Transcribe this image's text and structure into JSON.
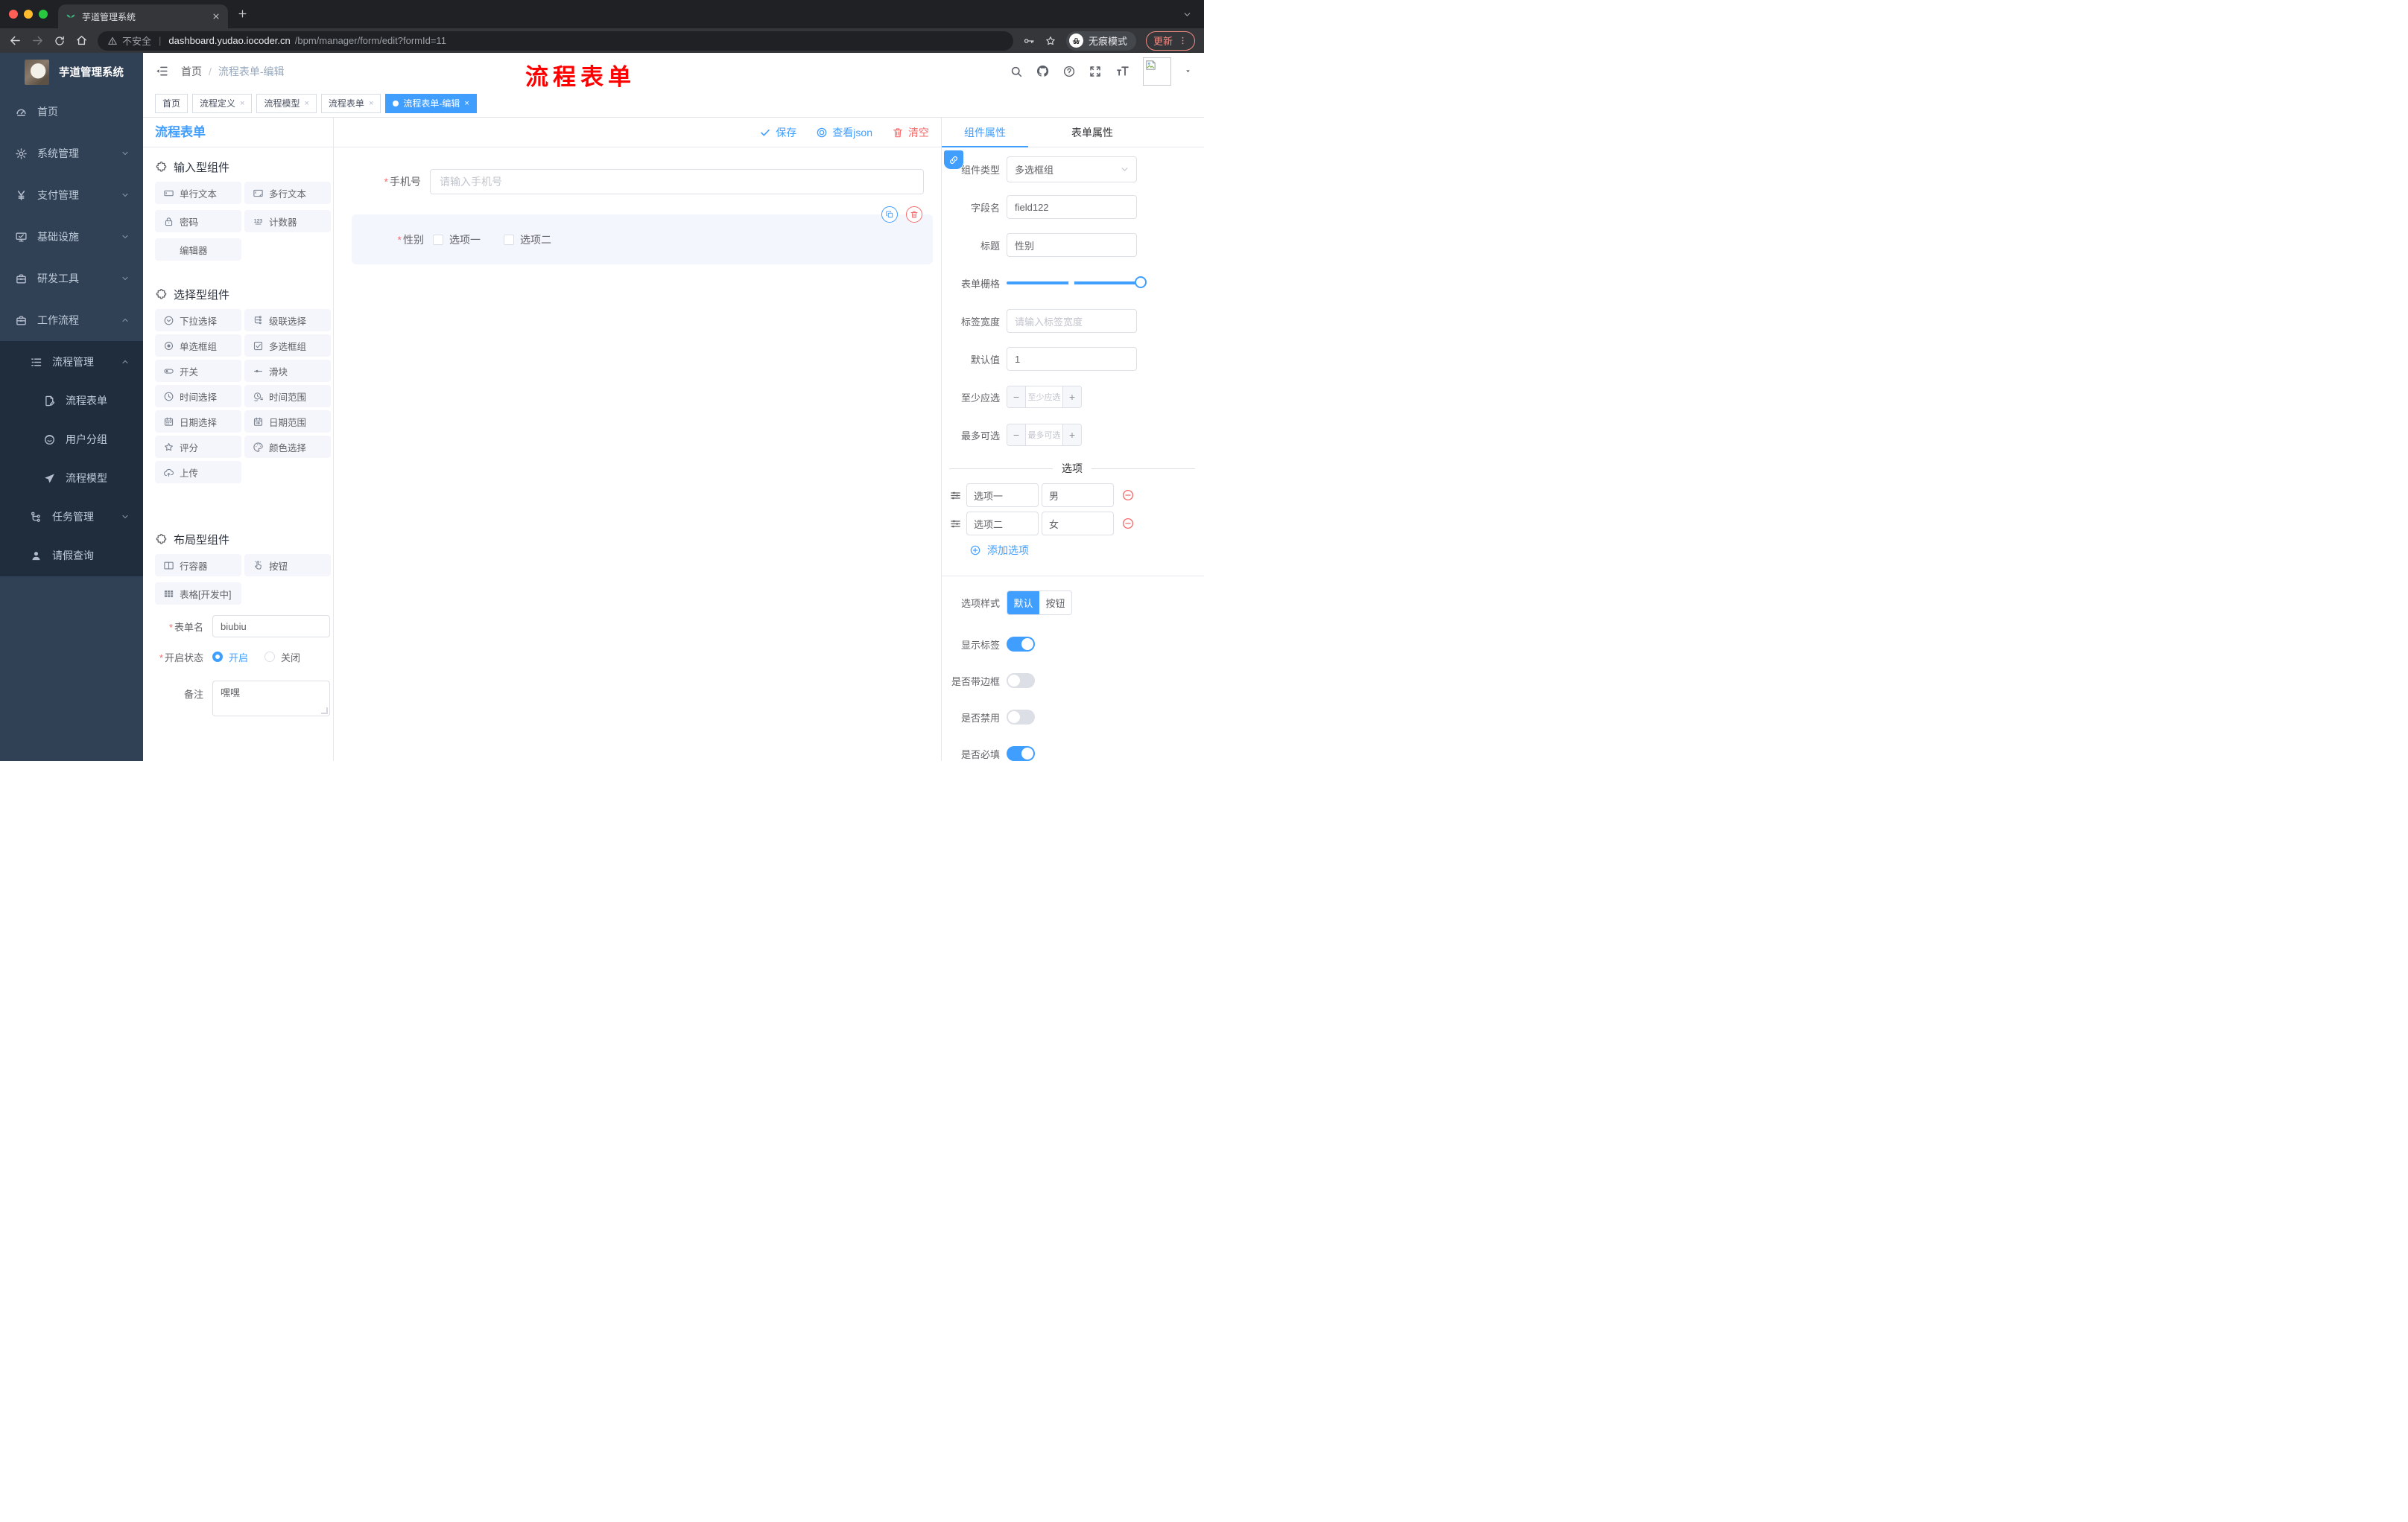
{
  "colors": {
    "primary": "#409eff",
    "danger": "#f56c6c",
    "sidebar_bg": "#304156",
    "submenu_bg": "#1f2d3d",
    "annotation": "#fe0000",
    "active_tab": "#409eff"
  },
  "browser": {
    "tab": {
      "title": "芋道管理系统"
    },
    "url": {
      "security": "不安全",
      "host": "dashboard.yudao.iocoder.cn",
      "path": "/bpm/manager/form/edit?formId=11"
    },
    "incognito_label": "无痕模式",
    "update_label": "更新"
  },
  "annotation": {
    "text": "流程表单"
  },
  "sidebar": {
    "logo_title": "芋道管理系统",
    "menu": [
      {
        "label": "首页",
        "icon": "#i-dash",
        "ind": "l1",
        "chev": false,
        "chevdir": ""
      },
      {
        "label": "系统管理",
        "icon": "#i-gear",
        "ind": "l1",
        "chev": true,
        "chevdir": "dn"
      },
      {
        "label": "支付管理",
        "icon": "#i-yen",
        "ind": "l1",
        "chev": true,
        "chevdir": "dn"
      },
      {
        "label": "基础设施",
        "icon": "#i-monitor",
        "ind": "l1",
        "chev": true,
        "chevdir": "dn"
      },
      {
        "label": "研发工具",
        "icon": "#i-toolbox",
        "ind": "l1",
        "chev": true,
        "chevdir": "dn"
      },
      {
        "label": "工作流程",
        "icon": "#i-toolbox",
        "ind": "l1",
        "chev": true,
        "chevdir": "up"
      }
    ],
    "submenu": [
      {
        "label": "流程管理",
        "icon": "#i-listtree",
        "ind": "l2",
        "chev": true,
        "chevdir": "up"
      },
      {
        "label": "流程表单",
        "icon": "#i-docedit",
        "ind": "l3",
        "chev": false,
        "chevdir": ""
      },
      {
        "label": "用户分组",
        "icon": "#i-usersmile",
        "ind": "l3",
        "chev": false,
        "chevdir": ""
      },
      {
        "label": "流程模型",
        "icon": "#i-plane",
        "ind": "l3",
        "chev": false,
        "chevdir": ""
      },
      {
        "label": "任务管理",
        "icon": "#i-flow",
        "ind": "l2",
        "chev": true,
        "chevdir": "dn"
      },
      {
        "label": "请假查询",
        "icon": "#i-person",
        "ind": "l2",
        "chev": false,
        "chevdir": ""
      }
    ]
  },
  "header": {
    "breadcrumb": [
      "首页",
      "流程表单-编辑"
    ]
  },
  "tabs_bar": {
    "chips": [
      {
        "label": "首页",
        "closable": false,
        "dot": false,
        "state": ""
      },
      {
        "label": "流程定义",
        "closable": true,
        "dot": false,
        "state": ""
      },
      {
        "label": "流程模型",
        "closable": true,
        "dot": false,
        "state": ""
      },
      {
        "label": "流程表单",
        "closable": true,
        "dot": false,
        "state": ""
      },
      {
        "label": "流程表单-编辑",
        "closable": true,
        "dot": true,
        "state": "active"
      }
    ]
  },
  "builder": {
    "panel_title": "流程表单",
    "sections": [
      {
        "title": "输入型组件",
        "items": [
          {
            "icon": "#i-input",
            "label": "单行文本"
          },
          {
            "icon": "#i-textarea",
            "label": "多行文本"
          },
          {
            "icon": "#i-lock",
            "label": "密码"
          },
          {
            "icon": "#i-counter",
            "label": "计数器"
          },
          {
            "icon": "",
            "label": "编辑器"
          }
        ]
      },
      {
        "title": "选择型组件",
        "items": [
          {
            "icon": "#i-selectc",
            "label": "下拉选择"
          },
          {
            "icon": "#i-cascade",
            "label": "级联选择"
          },
          {
            "icon": "#i-radio",
            "label": "单选框组"
          },
          {
            "icon": "#i-checkbox",
            "label": "多选框组"
          },
          {
            "icon": "#i-switchic",
            "label": "开关"
          },
          {
            "icon": "#i-slider",
            "label": "滑块"
          },
          {
            "icon": "#i-clock",
            "label": "时间选择"
          },
          {
            "icon": "#i-clockr",
            "label": "时间范围"
          },
          {
            "icon": "#i-cal",
            "label": "日期选择"
          },
          {
            "icon": "#i-calr",
            "label": "日期范围"
          },
          {
            "icon": "#i-staro",
            "label": "评分"
          },
          {
            "icon": "#i-palette",
            "label": "颜色选择"
          },
          {
            "icon": "#i-cloudup",
            "label": "上传"
          }
        ]
      },
      {
        "title": "布局型组件",
        "items": [
          {
            "icon": "#i-rowbox",
            "label": "行容器"
          },
          {
            "icon": "#i-pointer",
            "label": "按钮"
          },
          {
            "icon": "#i-tablegrid",
            "label": "表格[开发中]"
          }
        ]
      }
    ],
    "meta": {
      "name_label": "表单名",
      "name_value": "biubiu",
      "status_label": "开启状态",
      "status_on": "开启",
      "status_off": "关闭",
      "remark_label": "备注",
      "remark_value": "嘿嘿"
    }
  },
  "canvas": {
    "toolbar": {
      "save": "保存",
      "view_json": "查看json",
      "clear": "清空"
    },
    "phone": {
      "label": "手机号",
      "placeholder": "请输入手机号"
    },
    "gender": {
      "label": "性别",
      "options": [
        "选项一",
        "选项二"
      ]
    }
  },
  "props": {
    "tabs": [
      "组件属性",
      "表单属性"
    ],
    "rows": {
      "component_type": {
        "label": "组件类型",
        "value": "多选框组"
      },
      "field_name": {
        "label": "字段名",
        "value": "field122"
      },
      "title": {
        "label": "标题",
        "value": "性别"
      },
      "grid": {
        "label": "表单栅格"
      },
      "label_width": {
        "label": "标签宽度",
        "placeholder": "请输入标签宽度"
      },
      "default_value": {
        "label": "默认值",
        "value": "1"
      },
      "min_select": {
        "label": "至少应选",
        "placeholder": "至少应选"
      },
      "max_select": {
        "label": "最多可选",
        "placeholder": "最多可选"
      }
    },
    "options_title": "选项",
    "options": [
      {
        "label": "选项一",
        "value": "男"
      },
      {
        "label": "选项二",
        "value": "女"
      }
    ],
    "add_option": "添加选项",
    "option_style": {
      "label": "选项样式",
      "choices": [
        "默认",
        "按钮"
      ],
      "active": 0
    },
    "switches": [
      {
        "label": "显示标签",
        "state": "on"
      },
      {
        "label": "是否带边框",
        "state": "off"
      },
      {
        "label": "是否禁用",
        "state": "off"
      },
      {
        "label": "是否必填",
        "state": "on"
      }
    ]
  }
}
